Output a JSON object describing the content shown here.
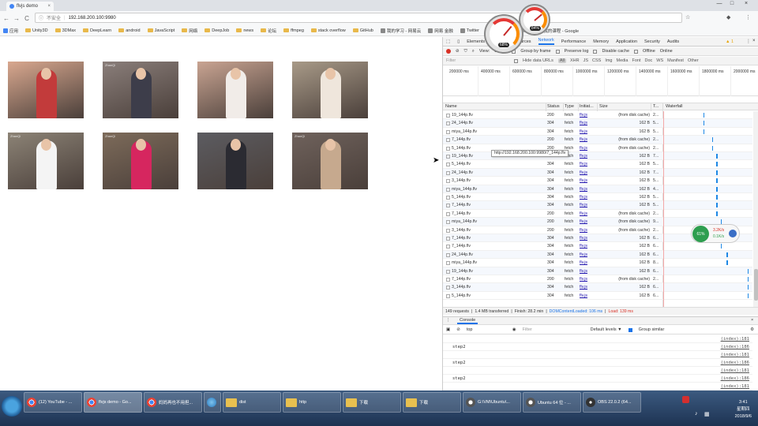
{
  "browser": {
    "tabs": [
      {
        "title": "flvjs demo",
        "close": "×"
      }
    ],
    "window_controls": {
      "minimize": "—",
      "maximize": "□",
      "close": "×"
    },
    "omnibox": {
      "security": "不安全",
      "url": "192.168.200.100:9980"
    },
    "nav": {
      "back": "←",
      "forward": "→",
      "reload": "C"
    },
    "bookmarks": [
      {
        "label": "应用",
        "kind": "apps"
      },
      {
        "label": "Unity3D",
        "kind": "folder"
      },
      {
        "label": "3DMax",
        "kind": "folder"
      },
      {
        "label": "DeepLearn",
        "kind": "folder"
      },
      {
        "label": "android",
        "kind": "folder"
      },
      {
        "label": "JavaScript",
        "kind": "folder"
      },
      {
        "label": "网络",
        "kind": "folder"
      },
      {
        "label": "DeepJob",
        "kind": "folder"
      },
      {
        "label": "news",
        "kind": "folder"
      },
      {
        "label": "论坛",
        "kind": "folder"
      },
      {
        "label": "ffmpeg",
        "kind": "folder"
      },
      {
        "label": "stack overflow",
        "kind": "folder"
      },
      {
        "label": "GitHub",
        "kind": "folder"
      },
      {
        "label": "我的学习 - 网易云",
        "kind": "link"
      },
      {
        "label": "网易 金融",
        "kind": "link"
      },
      {
        "label": "Twitter",
        "kind": "link"
      },
      {
        "label": "极客工坊-Arduino...",
        "kind": "link"
      },
      {
        "label": "我的课程 - Google",
        "kind": "link"
      }
    ]
  },
  "page": {
    "thumbnails": [
      {
        "watermark": "",
        "bg": "#d9a88f",
        "outfit": "#c23b3b"
      },
      {
        "watermark": "ZhanQi",
        "bg": "#8a7e7a",
        "outfit": "#3d3d4a"
      },
      {
        "watermark": "",
        "bg": "#c9a492",
        "outfit": "#f1ece8"
      },
      {
        "watermark": "",
        "bg": "#a89a88",
        "outfit": "#efe6dc"
      },
      {
        "watermark": "ZhanQi",
        "bg": "#8c8376",
        "outfit": "#f4f4f4"
      },
      {
        "watermark": "ZhanQi",
        "bg": "#7d6b5a",
        "outfit": "#d6265f"
      },
      {
        "watermark": "",
        "bg": "#5c5c61",
        "outfit": "#2b2b32"
      },
      {
        "watermark": "ZhanQi",
        "bg": "#6f625c",
        "outfit": "#c6a98e"
      }
    ]
  },
  "devtools": {
    "tabs": [
      "Elements",
      "Console",
      "Sources",
      "Network",
      "Performance",
      "Memory",
      "Application",
      "Security",
      "Audits"
    ],
    "active_tab": "Network",
    "warning_count": "▲ 1",
    "toolbar": {
      "view": "View:",
      "group_by_frame": "Group by frame",
      "preserve_log": "Preserve log",
      "disable_cache": "Disable cache",
      "offline": "Offline",
      "throttle": "Online"
    },
    "filter": {
      "placeholder": "Filter",
      "hide_data_urls": "Hide data URLs",
      "types": [
        "All",
        "XHR",
        "JS",
        "CSS",
        "Img",
        "Media",
        "Font",
        "Doc",
        "WS",
        "Manifest",
        "Other"
      ]
    },
    "overview_ticks": [
      "200000 ms",
      "400000 ms",
      "600000 ms",
      "800000 ms",
      "1000000 ms",
      "1200000 ms",
      "1400000 ms",
      "1600000 ms",
      "1800000 ms",
      "2000000 ms"
    ],
    "columns": {
      "name": "Name",
      "status": "Status",
      "type": "Type",
      "initiator": "Initiat...",
      "size": "Size",
      "time": "T...",
      "waterfall": "Waterfall"
    },
    "rows": [
      {
        "name": "19_144p.flv",
        "status": "200",
        "type": "fetch",
        "initiator": "flv.js",
        "size": "(from disk cache)",
        "time": "2...",
        "wf": 0.45
      },
      {
        "name": "24_144p.flv",
        "status": "304",
        "type": "fetch",
        "initiator": "flv.js",
        "size": "162 B",
        "time": "5...",
        "wf": 0.45
      },
      {
        "name": "miya_144p.flv",
        "status": "304",
        "type": "fetch",
        "initiator": "flv.js",
        "size": "162 B",
        "time": "5...",
        "wf": 0.45
      },
      {
        "name": "7_144p.flv",
        "status": "200",
        "type": "fetch",
        "initiator": "flv.js",
        "size": "(from disk cache)",
        "time": "2...",
        "wf": 0.55
      },
      {
        "name": "5_144p.flv",
        "status": "200",
        "type": "fetch",
        "initiator": "flv.js",
        "size": "(from disk cache)",
        "time": "2...",
        "wf": 0.55
      },
      {
        "name": "19_144p.flv",
        "status": "304",
        "type": "fetch",
        "initiator": "flv.js",
        "size": "162 B",
        "time": "7...",
        "wf": 0.6
      },
      {
        "name": "5_144p.flv",
        "status": "304",
        "type": "fetch",
        "initiator": "flv.js",
        "size": "162 B",
        "time": "5...",
        "wf": 0.6
      },
      {
        "name": "24_144p.flv",
        "status": "304",
        "type": "fetch",
        "initiator": "flv.js",
        "size": "162 B",
        "time": "7...",
        "wf": 0.6
      },
      {
        "name": "3_144p.flv",
        "status": "304",
        "type": "fetch",
        "initiator": "flv.js",
        "size": "162 B",
        "time": "5...",
        "wf": 0.6
      },
      {
        "name": "miya_144p.flv",
        "status": "304",
        "type": "fetch",
        "initiator": "flv.js",
        "size": "162 B",
        "time": "4...",
        "wf": 0.6
      },
      {
        "name": "5_144p.flv",
        "status": "304",
        "type": "fetch",
        "initiator": "flv.js",
        "size": "162 B",
        "time": "5...",
        "wf": 0.6
      },
      {
        "name": "7_144p.flv",
        "status": "304",
        "type": "fetch",
        "initiator": "flv.js",
        "size": "162 B",
        "time": "5...",
        "wf": 0.6
      },
      {
        "name": "7_144p.flv",
        "status": "200",
        "type": "fetch",
        "initiator": "flv.js",
        "size": "(from disk cache)",
        "time": "2...",
        "wf": 0.6
      },
      {
        "name": "miya_144p.flv",
        "status": "200",
        "type": "fetch",
        "initiator": "flv.js",
        "size": "(from disk cache)",
        "time": "9...",
        "wf": 0.65
      },
      {
        "name": "3_144p.flv",
        "status": "200",
        "type": "fetch",
        "initiator": "flv.js",
        "size": "(from disk cache)",
        "time": "2...",
        "wf": 0.65
      },
      {
        "name": "7_144p.flv",
        "status": "304",
        "type": "fetch",
        "initiator": "flv.js",
        "size": "162 B",
        "time": "6...",
        "wf": 0.65
      },
      {
        "name": "7_144p.flv",
        "status": "304",
        "type": "fetch",
        "initiator": "flv.js",
        "size": "162 B",
        "time": "6...",
        "wf": 0.65
      },
      {
        "name": "24_144p.flv",
        "status": "304",
        "type": "fetch",
        "initiator": "flv.js",
        "size": "162 B",
        "time": "6...",
        "wf": 0.72
      },
      {
        "name": "miya_144p.flv",
        "status": "304",
        "type": "fetch",
        "initiator": "flv.js",
        "size": "162 B",
        "time": "8...",
        "wf": 0.72
      },
      {
        "name": "19_144p.flv",
        "status": "304",
        "type": "fetch",
        "initiator": "flv.js",
        "size": "162 B",
        "time": "6...",
        "wf": 0.96
      },
      {
        "name": "7_144p.flv",
        "status": "200",
        "type": "fetch",
        "initiator": "flv.js",
        "size": "(from disk cache)",
        "time": "2...",
        "wf": 0.96
      },
      {
        "name": "3_144p.flv",
        "status": "304",
        "type": "fetch",
        "initiator": "flv.js",
        "size": "162 B",
        "time": "6...",
        "wf": 0.96
      },
      {
        "name": "5_144p.flv",
        "status": "304",
        "type": "fetch",
        "initiator": "flv.js",
        "size": "162 B",
        "time": "6...",
        "wf": 0.96
      }
    ],
    "tooltip": "http://192.168.200.100:9980/7_144p.flv",
    "summary": {
      "requests": "149 requests",
      "transferred": "1.4 MB transferred",
      "finish": "Finish: 28.2 min",
      "dcl": "DOMContentLoaded: 106 ms",
      "load": "Load: 139 ms"
    },
    "console": {
      "tab": "Console",
      "context": "top",
      "filter_placeholder": "Filter",
      "levels": "Default levels ▼",
      "group_similar": "Group similar",
      "lines": [
        {
          "msg": "",
          "src": "(index):181"
        },
        {
          "msg": "step2",
          "src": "(index):186"
        },
        {
          "msg": "",
          "src": "(index):181"
        },
        {
          "msg": "step2",
          "src": "(index):186"
        },
        {
          "msg": "",
          "src": "(index):181"
        },
        {
          "msg": "step2",
          "src": "(index):186"
        },
        {
          "msg": "",
          "src": "(index):181"
        }
      ]
    }
  },
  "overlays": {
    "gauge_large_pct": "68%",
    "gauge_small_pct": "84%",
    "speed": {
      "percent": "61%",
      "up": "3.2K/s",
      "down": "0.1K/s"
    }
  },
  "taskbar": {
    "tasks": [
      {
        "label": "(12) YouTube - ...",
        "icon": "chrome"
      },
      {
        "label": "flvjs demo - Go...",
        "icon": "chrome",
        "active": true
      },
      {
        "label": "妈妈再也不用担...",
        "icon": "chrome"
      },
      {
        "label": "",
        "icon": "app"
      },
      {
        "label": "dist",
        "icon": "folder"
      },
      {
        "label": "http",
        "icon": "folder"
      },
      {
        "label": "下载",
        "icon": "folder"
      },
      {
        "label": "下载",
        "icon": "folder"
      },
      {
        "label": "G:\\VM\\Ubuntu\\...",
        "icon": "vmware"
      },
      {
        "label": "Ubuntu 64 位 - ...",
        "icon": "vmware"
      },
      {
        "label": "OBS 22.0.2 (64...",
        "icon": "obs"
      }
    ],
    "clock": {
      "time": "3:41",
      "weekday": "星期四",
      "date": "2018/9/6"
    }
  }
}
